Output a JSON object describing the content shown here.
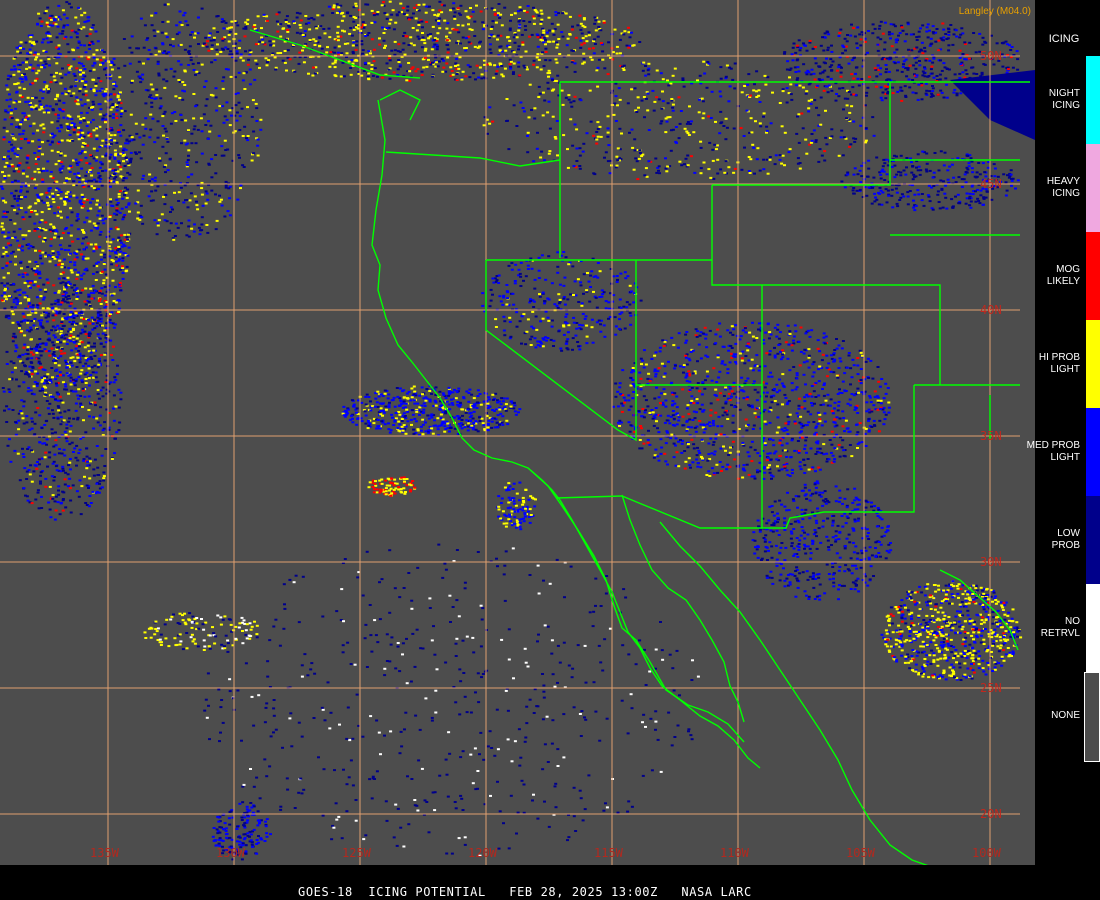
{
  "credit": "Langley (M04.0)",
  "footer_text": "GOES-18  ICING POTENTIAL   FEB 28, 2025 13:00Z   NASA LARC",
  "legend": {
    "title": "ICING",
    "items": [
      {
        "label": "NIGHT\nICING",
        "color": "#00ffff"
      },
      {
        "label": "HEAVY\nICING",
        "color": "#f0a8e0"
      },
      {
        "label": "MOG\nLIKELY",
        "color": "#ff0000"
      },
      {
        "label": "HI PROB\nLIGHT",
        "color": "#ffff00"
      },
      {
        "label": "MED PROB\nLIGHT",
        "color": "#0000ff"
      },
      {
        "label": "LOW\nPROB",
        "color": "#00008b"
      },
      {
        "label": "NO\nRETRVL",
        "color": "#ffffff"
      },
      {
        "label": "NONE",
        "color": "#4d4d4d"
      }
    ]
  },
  "latitudes": [
    {
      "label": "50N"
    },
    {
      "label": "45N"
    },
    {
      "label": "40N"
    },
    {
      "label": "35N"
    },
    {
      "label": "30N"
    },
    {
      "label": "25N"
    },
    {
      "label": "20N"
    }
  ],
  "longitudes": [
    {
      "label": "135W"
    },
    {
      "label": "130W"
    },
    {
      "label": "125W"
    },
    {
      "label": "120W"
    },
    {
      "label": "115W"
    },
    {
      "label": "110W"
    },
    {
      "label": "105W"
    },
    {
      "label": "100W"
    }
  ],
  "colors": {
    "grid": "#e0a070",
    "coast": "#00ff00",
    "background": "#4d4d4d"
  }
}
